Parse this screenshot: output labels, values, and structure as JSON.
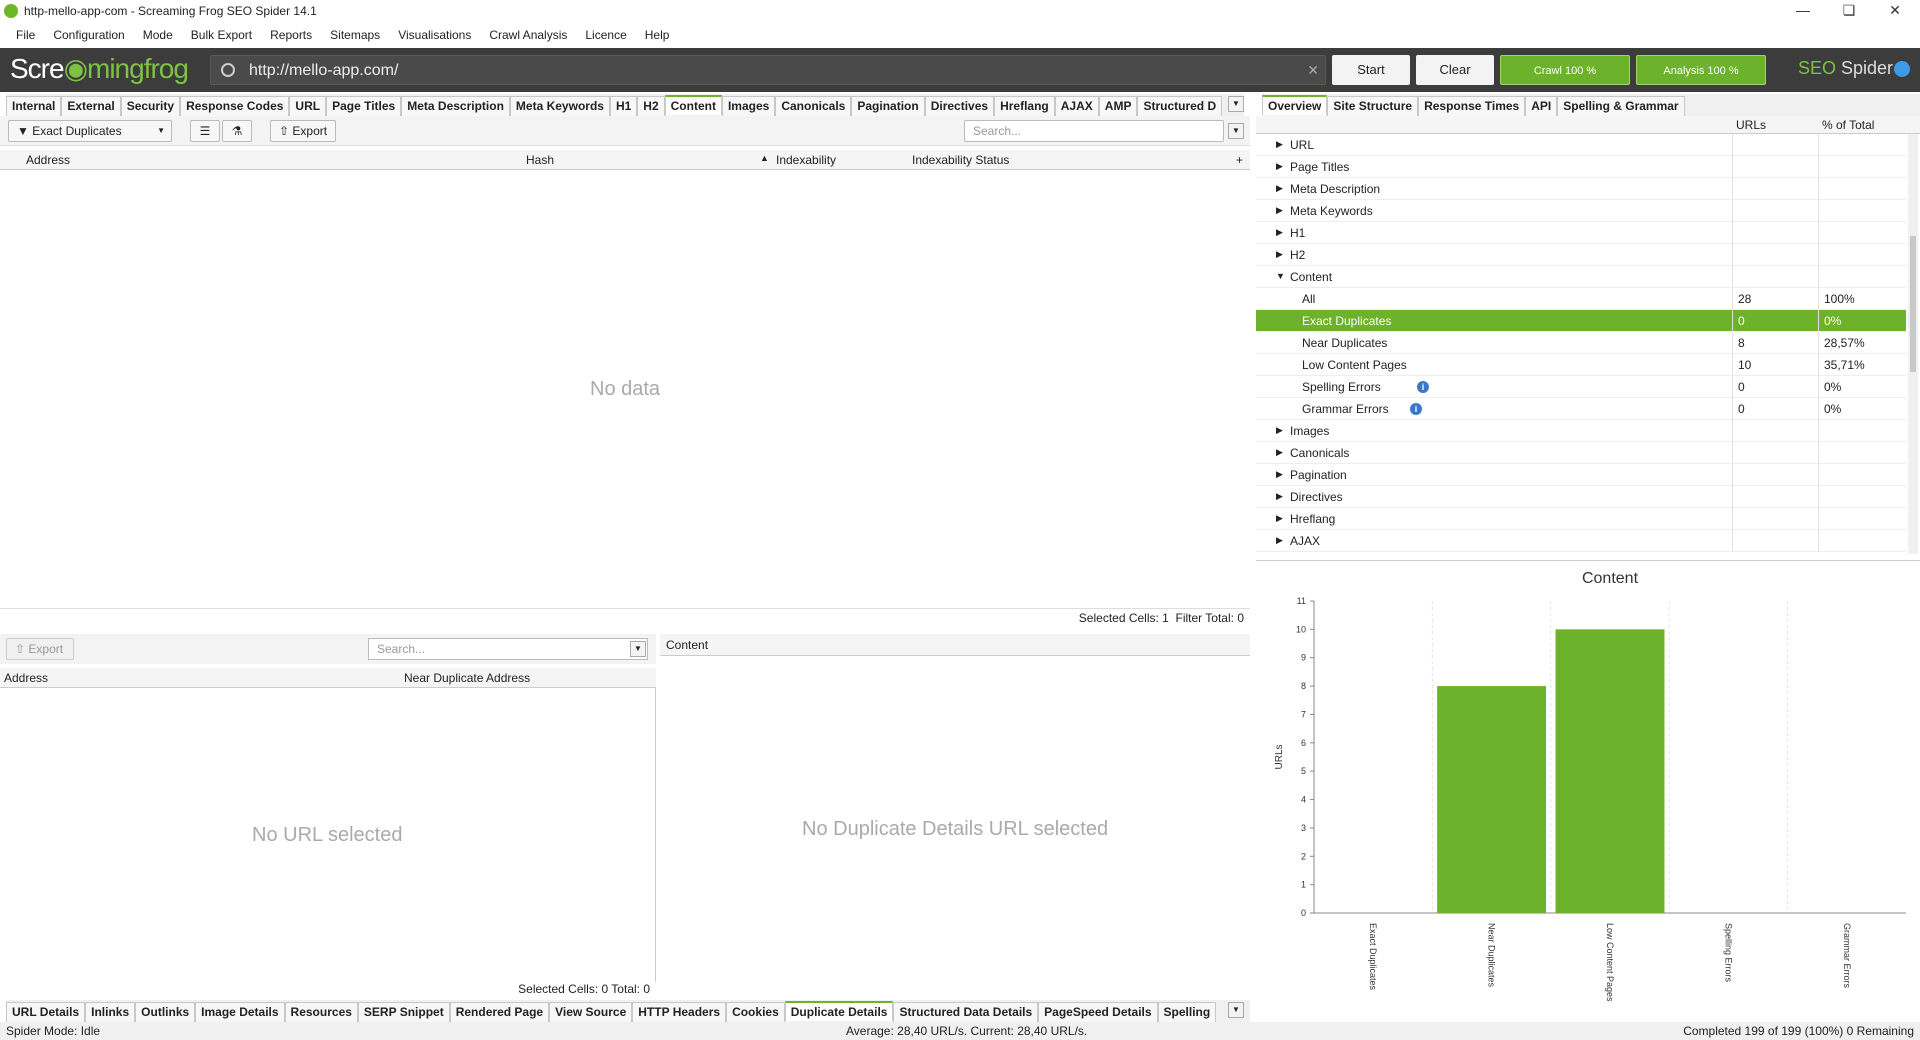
{
  "window": {
    "title": "http-mello-app-com - Screaming Frog SEO Spider 14.1"
  },
  "menu": [
    "File",
    "Configuration",
    "Mode",
    "Bulk Export",
    "Reports",
    "Sitemaps",
    "Visualisations",
    "Crawl Analysis",
    "Licence",
    "Help"
  ],
  "toolbar": {
    "logo_left": "Scre",
    "logo_mid": "mingfrog",
    "url": "http://mello-app.com/",
    "start": "Start",
    "clear": "Clear",
    "crawl": "Crawl 100 %",
    "analysis": "Analysis 100 %",
    "brand_seo": "SEO",
    "brand_spider": " Spider"
  },
  "top_tabs": [
    "Internal",
    "External",
    "Security",
    "Response Codes",
    "URL",
    "Page Titles",
    "Meta Description",
    "Meta Keywords",
    "H1",
    "H2",
    "Content",
    "Images",
    "Canonicals",
    "Pagination",
    "Directives",
    "Hreflang",
    "AJAX",
    "AMP",
    "Structured D"
  ],
  "top_tabs_active": "Content",
  "filter": {
    "selected": "Exact Duplicates",
    "export": "Export",
    "search_placeholder": "Search..."
  },
  "main_table": {
    "columns": [
      "Address",
      "Hash",
      "Indexability",
      "Indexability Status"
    ],
    "empty": "No data",
    "status_selected": "Selected Cells:  1",
    "status_filter": "Filter Total:  0"
  },
  "bottom_left": {
    "export": "Export",
    "search_placeholder": "Search...",
    "columns": [
      "Address",
      "Near Duplicate Address"
    ],
    "empty": "No URL selected",
    "status": "Selected Cells:  0  Total:  0"
  },
  "bottom_right": {
    "header": "Content",
    "empty": "No Duplicate Details URL selected"
  },
  "bottom_tabs": [
    "URL Details",
    "Inlinks",
    "Outlinks",
    "Image Details",
    "Resources",
    "SERP Snippet",
    "Rendered Page",
    "View Source",
    "HTTP Headers",
    "Cookies",
    "Duplicate Details",
    "Structured Data Details",
    "PageSpeed Details",
    "Spelling"
  ],
  "bottom_tabs_active": "Duplicate Details",
  "right_tabs": [
    "Overview",
    "Site Structure",
    "Response Times",
    "API",
    "Spelling & Grammar"
  ],
  "right_tabs_active": "Overview",
  "overview": {
    "col_urls": "URLs",
    "col_pct": "% of Total",
    "rows": [
      {
        "label": "URL",
        "level": 0,
        "expanded": false
      },
      {
        "label": "Page Titles",
        "level": 0,
        "expanded": false
      },
      {
        "label": "Meta Description",
        "level": 0,
        "expanded": false
      },
      {
        "label": "Meta Keywords",
        "level": 0,
        "expanded": false
      },
      {
        "label": "H1",
        "level": 0,
        "expanded": false
      },
      {
        "label": "H2",
        "level": 0,
        "expanded": false
      },
      {
        "label": "Content",
        "level": 0,
        "expanded": true
      },
      {
        "label": "All",
        "level": 1,
        "urls": "28",
        "pct": "100%"
      },
      {
        "label": "Exact Duplicates",
        "level": 1,
        "urls": "0",
        "pct": "0%",
        "selected": true
      },
      {
        "label": "Near Duplicates",
        "level": 1,
        "urls": "8",
        "pct": "28,57%"
      },
      {
        "label": "Low Content Pages",
        "level": 1,
        "urls": "10",
        "pct": "35,71%"
      },
      {
        "label": "Spelling Errors",
        "level": 1,
        "urls": "0",
        "pct": "0%",
        "info": true
      },
      {
        "label": "Grammar Errors",
        "level": 1,
        "urls": "0",
        "pct": "0%",
        "info": true
      },
      {
        "label": "Images",
        "level": 0,
        "expanded": false
      },
      {
        "label": "Canonicals",
        "level": 0,
        "expanded": false
      },
      {
        "label": "Pagination",
        "level": 0,
        "expanded": false
      },
      {
        "label": "Directives",
        "level": 0,
        "expanded": false
      },
      {
        "label": "Hreflang",
        "level": 0,
        "expanded": false
      },
      {
        "label": "AJAX",
        "level": 0,
        "expanded": false
      }
    ]
  },
  "chart_data": {
    "type": "bar",
    "title": "Content",
    "ylabel": "URLs",
    "xlabel": "",
    "categories": [
      "Exact Duplicates",
      "Near Duplicates",
      "Low Content Pages",
      "Spelling Errors",
      "Grammar Errors"
    ],
    "values": [
      0,
      8,
      10,
      0,
      0
    ],
    "ylim": [
      0,
      11
    ],
    "yticks": [
      0,
      1,
      2,
      3,
      4,
      5,
      6,
      7,
      8,
      9,
      10,
      11
    ],
    "color": "#6db22b",
    "grid": true
  },
  "status": {
    "left": "Spider Mode: Idle",
    "center": "Average: 28,40 URL/s. Current: 28,40 URL/s.",
    "right": "Completed 199 of 199 (100%) 0 Remaining"
  }
}
